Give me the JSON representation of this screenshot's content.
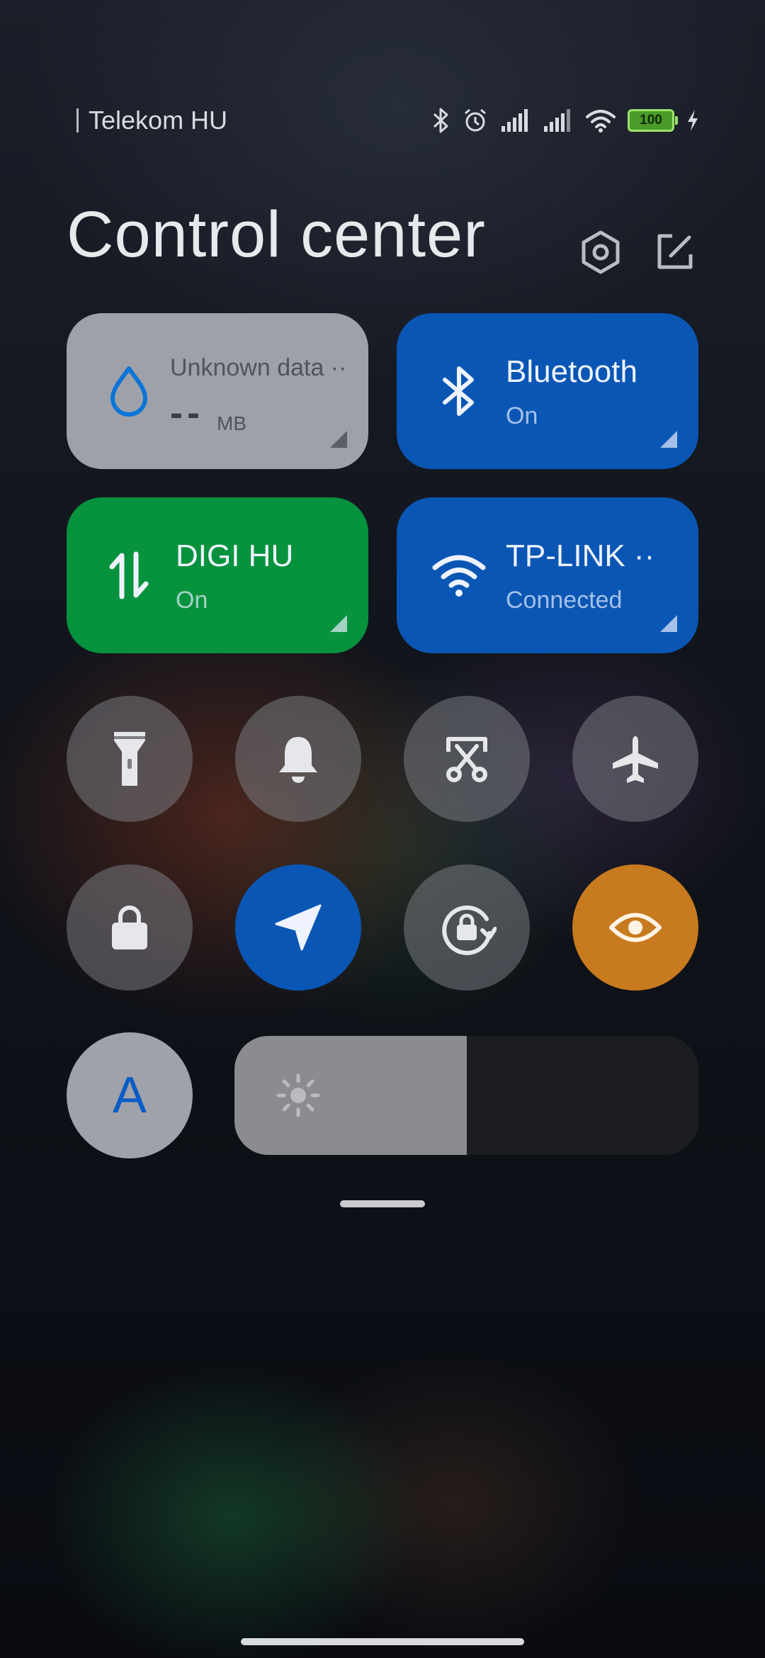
{
  "status_bar": {
    "carrier": "Telekom HU",
    "battery_level": "100",
    "icons": [
      "bluetooth-icon",
      "alarm-icon",
      "signal-icon-sim1",
      "signal-icon-sim2",
      "wifi-icon",
      "battery-icon",
      "charging-icon"
    ]
  },
  "header": {
    "title": "Control center",
    "settings_icon": "settings-hex-icon",
    "edit_icon": "edit-icon"
  },
  "tiles": {
    "data": {
      "title": "Unknown data ··",
      "value": "--",
      "unit": "MB",
      "icon": "water-drop-icon"
    },
    "bluetooth": {
      "title": "Bluetooth",
      "status": "On",
      "icon": "bluetooth-icon"
    },
    "mobile_data": {
      "title": "DIGI HU",
      "status": "On",
      "icon": "mobile-data-arrows-icon"
    },
    "wifi": {
      "title": "TP-LINK ··",
      "status": "Connected",
      "icon": "wifi-icon"
    }
  },
  "toggles": [
    {
      "icon": "flashlight-icon",
      "state": "off"
    },
    {
      "icon": "bell-icon",
      "state": "off"
    },
    {
      "icon": "screenshot-icon",
      "state": "off"
    },
    {
      "icon": "airplane-icon",
      "state": "off"
    },
    {
      "icon": "lock-icon",
      "state": "off"
    },
    {
      "icon": "location-icon",
      "state": "on"
    },
    {
      "icon": "rotation-lock-icon",
      "state": "off"
    },
    {
      "icon": "reading-mode-eye-icon",
      "state": "on"
    }
  ],
  "auto_brightness": {
    "label": "A",
    "icon": "auto-brightness-icon"
  },
  "brightness": {
    "level": 0.5,
    "icon": "sun-icon"
  },
  "colors": {
    "blue": "#0a56b4",
    "green": "#07923d",
    "orange": "#c87a1e",
    "gray_tile": "#9ea1a7"
  }
}
